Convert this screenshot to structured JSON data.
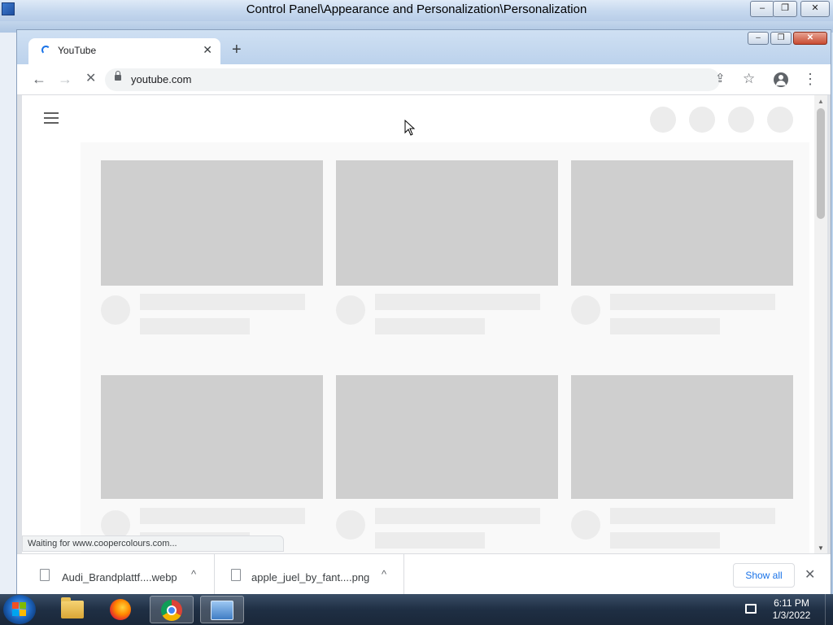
{
  "control_panel": {
    "title": "Control Panel\\Appearance and Personalization\\Personalization",
    "minimize": "‒",
    "maximize": "❐",
    "close": "✕"
  },
  "browser": {
    "tab": {
      "title": "YouTube",
      "close": "✕"
    },
    "new_tab": "+",
    "window": {
      "minimize": "‒",
      "maximize": "❐",
      "close": "✕"
    },
    "toolbar": {
      "back": "←",
      "forward": "→",
      "stop": "✕",
      "url": "youtube.com",
      "share": "⇪",
      "bookmark": "☆",
      "menu": "⋮"
    },
    "status": "Waiting for www.coopercolours.com...",
    "downloads": [
      {
        "name": "Audi_Brandplattf....webp",
        "chevron": "^"
      },
      {
        "name": "apple_juel_by_fant....png",
        "chevron": "^"
      }
    ],
    "show_all": "Show all",
    "downloads_close": "✕",
    "scroll_up": "▲",
    "scroll_down": "▼"
  },
  "taskbar": {
    "apps": [
      {
        "name": "windows-explorer"
      },
      {
        "name": "firefox"
      },
      {
        "name": "chrome",
        "active": true
      },
      {
        "name": "control-panel"
      }
    ],
    "time": "6:11 PM",
    "date": "1/3/2022"
  },
  "colors": {
    "skeleton_thumb": "#cfcfcf",
    "skeleton_light": "#ececec",
    "accent": "#1a73e8"
  }
}
